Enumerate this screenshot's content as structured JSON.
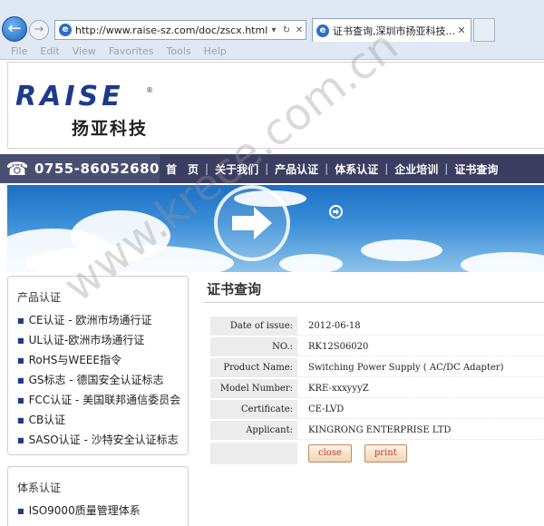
{
  "browser": {
    "url": "http://www.raise-sz.com/doc/zscx.html",
    "addr_controls": [
      "▾",
      "↻",
      "✕"
    ],
    "tab_title": "证书查询,深圳市扬亚科技...",
    "tab_close": "✕",
    "menu": [
      "File",
      "Edit",
      "View",
      "Favorites",
      "Tools",
      "Help"
    ]
  },
  "header": {
    "logo_en": "RAISE",
    "logo_reg": "®",
    "logo_cn": "扬亚科技"
  },
  "contact": {
    "phone": "0755-86052680"
  },
  "nav": {
    "items": [
      "首　页",
      "关于我们",
      "产品认证",
      "体系认证",
      "企业培训",
      "证书查询"
    ],
    "separator": "|"
  },
  "sidebar": {
    "product_title": "产品认证",
    "product_items": [
      "CE认证 - 欧洲市场通行证",
      "UL认证-欧洲市场通行证",
      "RoHS与WEEE指令",
      "GS标志 - 德国安全认证标志",
      "FCC认证 - 美国联邦通信委员会",
      "CB认证",
      "SASO认证 - 沙特安全认证标志"
    ],
    "system_title": "体系认证",
    "system_items": [
      "ISO9000质量管理体系"
    ]
  },
  "content": {
    "title": "证书查询",
    "rows": [
      {
        "label": "Date of issue:",
        "value": "2012-06-18"
      },
      {
        "label": "NO.:",
        "value": "RK12S06020"
      },
      {
        "label": "Product Name:",
        "value": "Switching Power Supply ( AC/DC Adapter)"
      },
      {
        "label": "Model Number:",
        "value": "KRE-xxxyyyZ"
      },
      {
        "label": "Certificate:",
        "value": "CE-LVD"
      },
      {
        "label": "Applicant:",
        "value": "KINGRONG ENTERPRISE LTD"
      }
    ],
    "close_label": "close",
    "print_label": "print"
  },
  "watermark": "www.krece.com.cn",
  "colors": {
    "nav_bg": "#3b3e60",
    "phone_bg": "#4a4f72",
    "logo_blue": "#1e3a8a",
    "button_text": "#c0392b"
  }
}
